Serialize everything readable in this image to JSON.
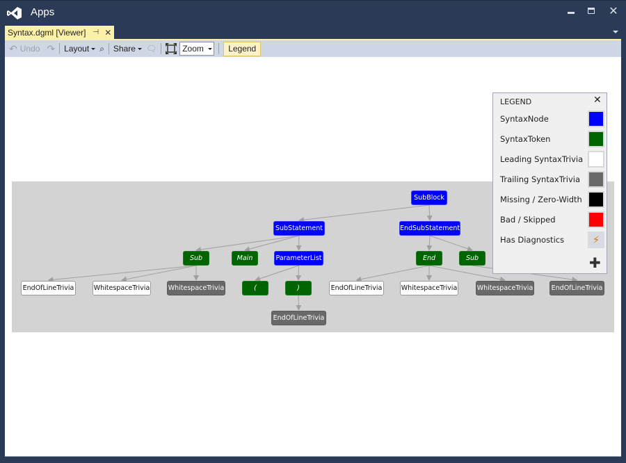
{
  "window": {
    "title": "Apps",
    "controls": {
      "minimize": "minimize",
      "maximize": "maximize",
      "close": "✕"
    }
  },
  "tab": {
    "label": "Syntax.dgml [Viewer]",
    "pin_icon": "⊣",
    "close_icon": "✕"
  },
  "toolbar": {
    "undo_label": "Undo",
    "layout_label": "Layout",
    "share_label": "Share",
    "zoom_value": "Zoom",
    "legend_label": "Legend"
  },
  "legend": {
    "title": "LEGEND",
    "close_icon": "✕",
    "add_icon": "✚",
    "items": [
      {
        "label": "SyntaxNode",
        "color": "#0000ff"
      },
      {
        "label": "SyntaxToken",
        "color": "#006400"
      },
      {
        "label": "Leading SyntaxTrivia",
        "color": "#ffffff"
      },
      {
        "label": "Trailing SyntaxTrivia",
        "color": "#696969"
      },
      {
        "label": "Missing / Zero-Width",
        "color": "#000000"
      },
      {
        "label": "Bad / Skipped",
        "color": "#ff0000"
      },
      {
        "label": "Has Diagnostics",
        "icon": "⚡"
      }
    ]
  },
  "graph": {
    "nodes": [
      {
        "id": "subblock",
        "label": "SubBlock",
        "kind": "syntaxnode"
      },
      {
        "id": "substatement",
        "label": "SubStatement",
        "kind": "syntaxnode"
      },
      {
        "id": "endsubstatement",
        "label": "EndSubStatement",
        "kind": "syntaxnode"
      },
      {
        "id": "sub1",
        "label": "Sub",
        "kind": "syntaxtoken"
      },
      {
        "id": "main",
        "label": "Main",
        "kind": "syntaxtoken"
      },
      {
        "id": "paramlist",
        "label": "ParameterList",
        "kind": "syntaxnode"
      },
      {
        "id": "end",
        "label": "End",
        "kind": "syntaxtoken"
      },
      {
        "id": "sub2",
        "label": "Sub",
        "kind": "syntaxtoken"
      },
      {
        "id": "eol1",
        "label": "EndOfLineTrivia",
        "kind": "leading"
      },
      {
        "id": "ws1",
        "label": "WhitespaceTrivia",
        "kind": "leading"
      },
      {
        "id": "ws2",
        "label": "WhitespaceTrivia",
        "kind": "trailing"
      },
      {
        "id": "lparen",
        "label": "(",
        "kind": "syntaxtoken"
      },
      {
        "id": "rparen",
        "label": ")",
        "kind": "syntaxtoken"
      },
      {
        "id": "eol2",
        "label": "EndOfLineTrivia",
        "kind": "trailing"
      },
      {
        "id": "eol3",
        "label": "EndOfLineTrivia",
        "kind": "leading"
      },
      {
        "id": "ws3",
        "label": "WhitespaceTrivia",
        "kind": "leading"
      },
      {
        "id": "ws4",
        "label": "WhitespaceTrivia",
        "kind": "trailing"
      },
      {
        "id": "eol4",
        "label": "EndOfLineTrivia",
        "kind": "trailing"
      }
    ],
    "edges": [
      [
        "subblock",
        "substatement"
      ],
      [
        "subblock",
        "endsubstatement"
      ],
      [
        "substatement",
        "sub1"
      ],
      [
        "substatement",
        "main"
      ],
      [
        "substatement",
        "paramlist"
      ],
      [
        "sub1",
        "eol1"
      ],
      [
        "sub1",
        "ws1"
      ],
      [
        "sub1",
        "ws2"
      ],
      [
        "paramlist",
        "lparen"
      ],
      [
        "paramlist",
        "rparen"
      ],
      [
        "rparen",
        "eol2"
      ],
      [
        "endsubstatement",
        "end"
      ],
      [
        "endsubstatement",
        "sub2"
      ],
      [
        "end",
        "eol3"
      ],
      [
        "end",
        "ws3"
      ],
      [
        "end",
        "ws4"
      ],
      [
        "sub2",
        "eol4"
      ]
    ]
  }
}
